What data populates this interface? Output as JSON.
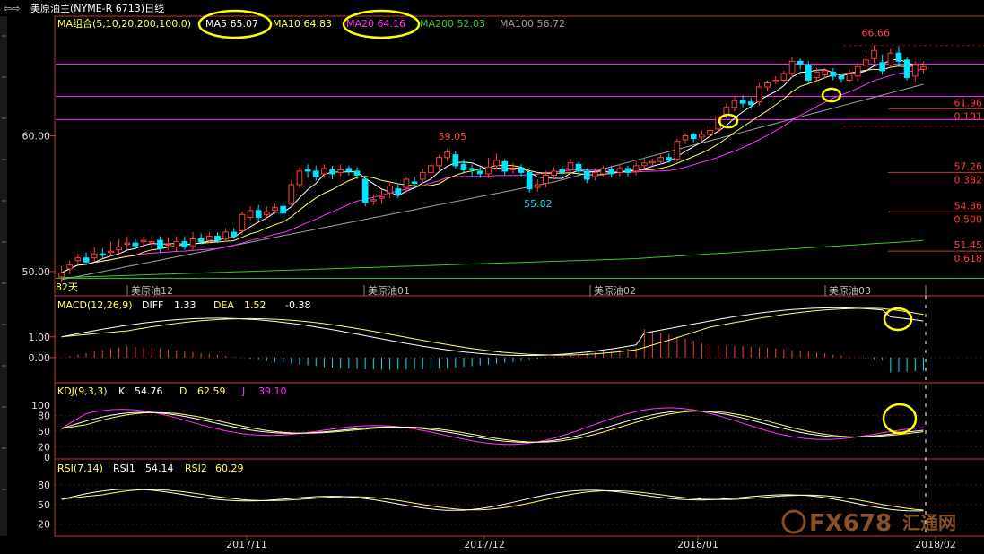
{
  "title": "美原油主(NYME-R 6713)日线",
  "title_icon": "back-arrows-icon",
  "colors": {
    "bg": "#000000",
    "up": "#ff3b3b",
    "down": "#00e5ff",
    "ma5": "#ffffff",
    "ma10": "#ffff66",
    "ma20": "#ff33ff",
    "ma100": "#a0a0a0",
    "ma200": "#33cc33",
    "grid": "#b00000",
    "axis": "#cc3333",
    "level": "#ff33ff",
    "highlight": "#ffff00"
  },
  "ma_legend": [
    {
      "text": "MA组合(5,10,20,200,100,0)",
      "color": "#ffff66"
    },
    {
      "text": "MA5 65.07",
      "color": "#ffffff"
    },
    {
      "text": "MA10 64.83",
      "color": "#ffff66"
    },
    {
      "text": "MA20 64.16",
      "color": "#ff33ff"
    },
    {
      "text": "MA200 52.03",
      "color": "#33cc33"
    },
    {
      "text": "MA100 56.72",
      "color": "#a0a0a0"
    }
  ],
  "price_ticks": [
    "60.00",
    "50.00"
  ],
  "price_labels": {
    "high": "66.66",
    "mid": "59.05",
    "low": "55.82",
    "start": "82天"
  },
  "fib_levels": [
    {
      "price": "61.96",
      "ratio": "0.191"
    },
    {
      "price": "57.26",
      "ratio": "0.382"
    },
    {
      "price": "54.36",
      "ratio": "0.500"
    },
    {
      "price": "51.45",
      "ratio": "0.618"
    }
  ],
  "contract_labels": [
    "美原油12",
    "美原油01",
    "美原油02",
    "美原油03"
  ],
  "macd": {
    "label": "MACD(12,26,9)",
    "diff_label": "DIFF",
    "diff": "1.33",
    "dea_label": "DEA",
    "dea": "1.52",
    "macd": "-0.38",
    "ticks": [
      "1.00",
      "0.00"
    ]
  },
  "kdj": {
    "label": "KDJ(9,3,3)",
    "k_label": "K",
    "k": "54.76",
    "d_label": "D",
    "d": "62.59",
    "j_label": "J",
    "j": "39.10",
    "ticks": [
      "100",
      "80",
      "50",
      "20",
      "0"
    ]
  },
  "rsi": {
    "label": "RSI(7,14)",
    "rsi1_label": "RSI1",
    "rsi1": "54.14",
    "rsi2_label": "RSI2",
    "rsi2": "60.29",
    "ticks": [
      "80",
      "50",
      "20"
    ]
  },
  "date_labels": [
    "2017/11",
    "2017/12",
    "2018/01",
    "2018/02"
  ],
  "watermark": {
    "text": "FX678",
    "cn": "汇通网"
  },
  "chart_data": {
    "type": "candlestick",
    "title": "美原油主(NYME-R 6713)日线",
    "ylim": [
      49,
      67.7
    ],
    "candles": [
      [
        49.6,
        49.9,
        49.2,
        50.4
      ],
      [
        50.2,
        50.5,
        49.8,
        50.8
      ],
      [
        50.8,
        51.0,
        50.4,
        51.3
      ],
      [
        51.0,
        50.7,
        50.5,
        51.4
      ],
      [
        51.0,
        51.3,
        50.7,
        51.8
      ],
      [
        51.3,
        51.2,
        50.9,
        51.7
      ],
      [
        51.4,
        51.5,
        51.1,
        52.2
      ],
      [
        51.6,
        51.8,
        51.2,
        52.4
      ],
      [
        52.0,
        52.1,
        51.6,
        52.6
      ],
      [
        52.1,
        51.9,
        51.6,
        52.4
      ],
      [
        52.2,
        52.3,
        51.8,
        52.6
      ],
      [
        52.1,
        52.2,
        51.7,
        52.6
      ],
      [
        52.3,
        51.7,
        51.4,
        52.6
      ],
      [
        52.0,
        52.0,
        51.6,
        52.5
      ],
      [
        51.8,
        52.2,
        51.5,
        52.6
      ],
      [
        52.2,
        51.8,
        51.6,
        52.6
      ],
      [
        51.9,
        52.4,
        51.6,
        52.9
      ],
      [
        52.4,
        52.2,
        52.0,
        52.8
      ],
      [
        52.3,
        52.6,
        52.1,
        52.9
      ],
      [
        52.6,
        52.3,
        52.1,
        52.9
      ],
      [
        52.4,
        52.9,
        52.2,
        53.2
      ],
      [
        52.9,
        52.6,
        52.4,
        53.2
      ],
      [
        53.0,
        54.2,
        52.7,
        54.4
      ],
      [
        54.0,
        54.5,
        53.8,
        54.8
      ],
      [
        54.5,
        54.0,
        53.7,
        54.9
      ],
      [
        54.2,
        54.4,
        53.9,
        54.8
      ],
      [
        54.5,
        54.7,
        54.2,
        55.0
      ],
      [
        54.8,
        54.3,
        54.0,
        55.1
      ],
      [
        55.0,
        56.4,
        54.8,
        56.7
      ],
      [
        56.4,
        57.4,
        56.1,
        57.7
      ],
      [
        57.5,
        57.4,
        56.9,
        57.9
      ],
      [
        57.4,
        57.0,
        56.7,
        57.8
      ],
      [
        57.2,
        57.6,
        56.9,
        57.9
      ],
      [
        57.5,
        57.2,
        56.8,
        57.8
      ],
      [
        57.3,
        57.5,
        57.0,
        57.9
      ],
      [
        57.6,
        57.4,
        57.1,
        57.8
      ],
      [
        57.4,
        57.1,
        56.8,
        57.7
      ],
      [
        56.8,
        55.1,
        54.8,
        57.0
      ],
      [
        55.2,
        55.3,
        54.9,
        55.7
      ],
      [
        55.4,
        55.5,
        55.0,
        56.0
      ],
      [
        55.8,
        56.3,
        55.4,
        56.6
      ],
      [
        56.1,
        55.7,
        55.4,
        56.4
      ],
      [
        56.2,
        56.8,
        55.8,
        57.0
      ],
      [
        56.6,
        56.5,
        56.2,
        57.0
      ],
      [
        56.8,
        57.3,
        56.5,
        57.6
      ],
      [
        57.3,
        57.8,
        57.0,
        58.0
      ],
      [
        57.8,
        58.4,
        57.5,
        58.6
      ],
      [
        58.4,
        58.8,
        58.1,
        59.05
      ],
      [
        58.6,
        57.8,
        57.6,
        58.9
      ],
      [
        57.9,
        57.5,
        57.2,
        58.3
      ],
      [
        57.6,
        57.5,
        57.0,
        57.9
      ],
      [
        57.4,
        57.2,
        56.9,
        57.7
      ],
      [
        57.2,
        57.7,
        56.9,
        58.4
      ],
      [
        57.8,
        58.2,
        57.5,
        58.7
      ],
      [
        58.1,
        57.4,
        57.1,
        58.3
      ],
      [
        57.5,
        57.6,
        57.2,
        58.0
      ],
      [
        57.6,
        57.3,
        57.0,
        57.9
      ],
      [
        57.3,
        56.1,
        55.82,
        57.4
      ],
      [
        56.2,
        56.4,
        55.9,
        56.8
      ],
      [
        56.5,
        57.1,
        56.2,
        57.4
      ],
      [
        57.1,
        57.4,
        56.8,
        57.7
      ],
      [
        57.5,
        57.3,
        56.9,
        57.8
      ],
      [
        57.5,
        58.0,
        57.2,
        58.3
      ],
      [
        57.9,
        57.4,
        57.1,
        58.1
      ],
      [
        57.4,
        56.8,
        56.5,
        57.6
      ],
      [
        57.0,
        57.3,
        56.7,
        57.6
      ],
      [
        57.2,
        57.6,
        57.0,
        57.8
      ],
      [
        57.5,
        57.2,
        56.9,
        57.8
      ],
      [
        57.3,
        57.6,
        57.0,
        57.9
      ],
      [
        57.6,
        57.3,
        57.0,
        57.8
      ],
      [
        57.4,
        57.8,
        57.1,
        58.1
      ],
      [
        57.8,
        58.0,
        57.5,
        58.3
      ],
      [
        58.0,
        58.1,
        57.8,
        58.3
      ],
      [
        58.1,
        58.4,
        57.9,
        58.6
      ],
      [
        58.4,
        58.2,
        58.0,
        58.7
      ],
      [
        58.3,
        59.6,
        58.1,
        59.8
      ],
      [
        59.7,
        60.0,
        59.4,
        60.2
      ],
      [
        60.1,
        59.8,
        59.5,
        60.2
      ],
      [
        59.9,
        60.1,
        59.6,
        60.4
      ],
      [
        60.1,
        60.4,
        59.9,
        60.7
      ],
      [
        60.5,
        61.4,
        60.2,
        61.6
      ],
      [
        61.6,
        62.1,
        61.3,
        62.4
      ],
      [
        62.1,
        62.6,
        61.8,
        62.9
      ],
      [
        62.6,
        62.4,
        62.1,
        63.0
      ],
      [
        62.5,
        62.3,
        62.0,
        62.8
      ],
      [
        62.5,
        63.6,
        62.2,
        63.9
      ],
      [
        63.6,
        63.9,
        63.3,
        64.1
      ],
      [
        64.0,
        64.1,
        63.8,
        64.4
      ],
      [
        64.1,
        64.6,
        63.9,
        64.8
      ],
      [
        64.6,
        65.5,
        64.3,
        65.8
      ],
      [
        65.5,
        65.3,
        64.9,
        65.7
      ],
      [
        65.2,
        64.1,
        63.8,
        65.5
      ],
      [
        64.3,
        64.7,
        64.0,
        65.0
      ],
      [
        64.5,
        64.8,
        64.2,
        65.0
      ],
      [
        64.7,
        64.4,
        64.1,
        65.0
      ],
      [
        64.4,
        64.2,
        63.9,
        64.6
      ],
      [
        64.1,
        64.6,
        63.9,
        64.9
      ],
      [
        64.4,
        65.1,
        64.0,
        65.4
      ],
      [
        65.2,
        65.6,
        64.9,
        65.9
      ],
      [
        65.7,
        66.3,
        65.4,
        66.66
      ],
      [
        65.4,
        64.8,
        64.5,
        66.0
      ],
      [
        65.2,
        66.1,
        65.0,
        66.4
      ],
      [
        66.1,
        65.5,
        65.1,
        66.6
      ],
      [
        65.6,
        64.3,
        64.1,
        65.8
      ],
      [
        64.4,
        65.2,
        64.0,
        65.5
      ],
      [
        64.9,
        65.1,
        64.6,
        65.5
      ]
    ],
    "macd_ticks": [
      1.0,
      0.0
    ],
    "kdj_ticks": [
      100,
      80,
      50,
      20,
      0
    ],
    "rsi_ticks": [
      80,
      50,
      20
    ]
  }
}
